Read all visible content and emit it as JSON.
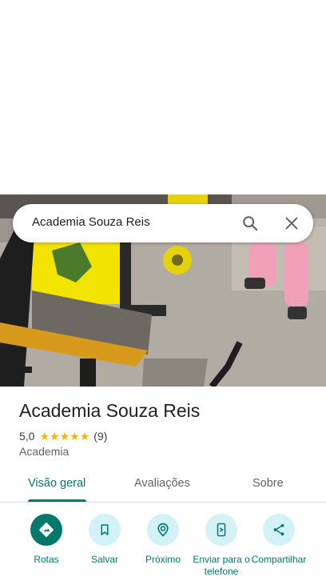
{
  "search": {
    "query": "Academia Souza Reis"
  },
  "place": {
    "name": "Academia Souza Reis",
    "rating": "5,0",
    "stars": 5,
    "review_count": "(9)",
    "category": "Academia"
  },
  "tabs": [
    {
      "label": "Visão geral",
      "active": true
    },
    {
      "label": "Avaliações",
      "active": false
    },
    {
      "label": "Sobre",
      "active": false
    }
  ],
  "actions": [
    {
      "label": "Rotas",
      "icon": "directions-icon"
    },
    {
      "label": "Salvar",
      "icon": "bookmark-icon"
    },
    {
      "label": "Próximo",
      "icon": "nearby-icon"
    },
    {
      "label": "Enviar para o telefone",
      "icon": "send-to-phone-icon"
    },
    {
      "label": "Compartilhar",
      "icon": "share-icon"
    }
  ],
  "colors": {
    "accent": "#00796b",
    "action_bg": "#d2f2f7",
    "star": "#f5b400"
  }
}
